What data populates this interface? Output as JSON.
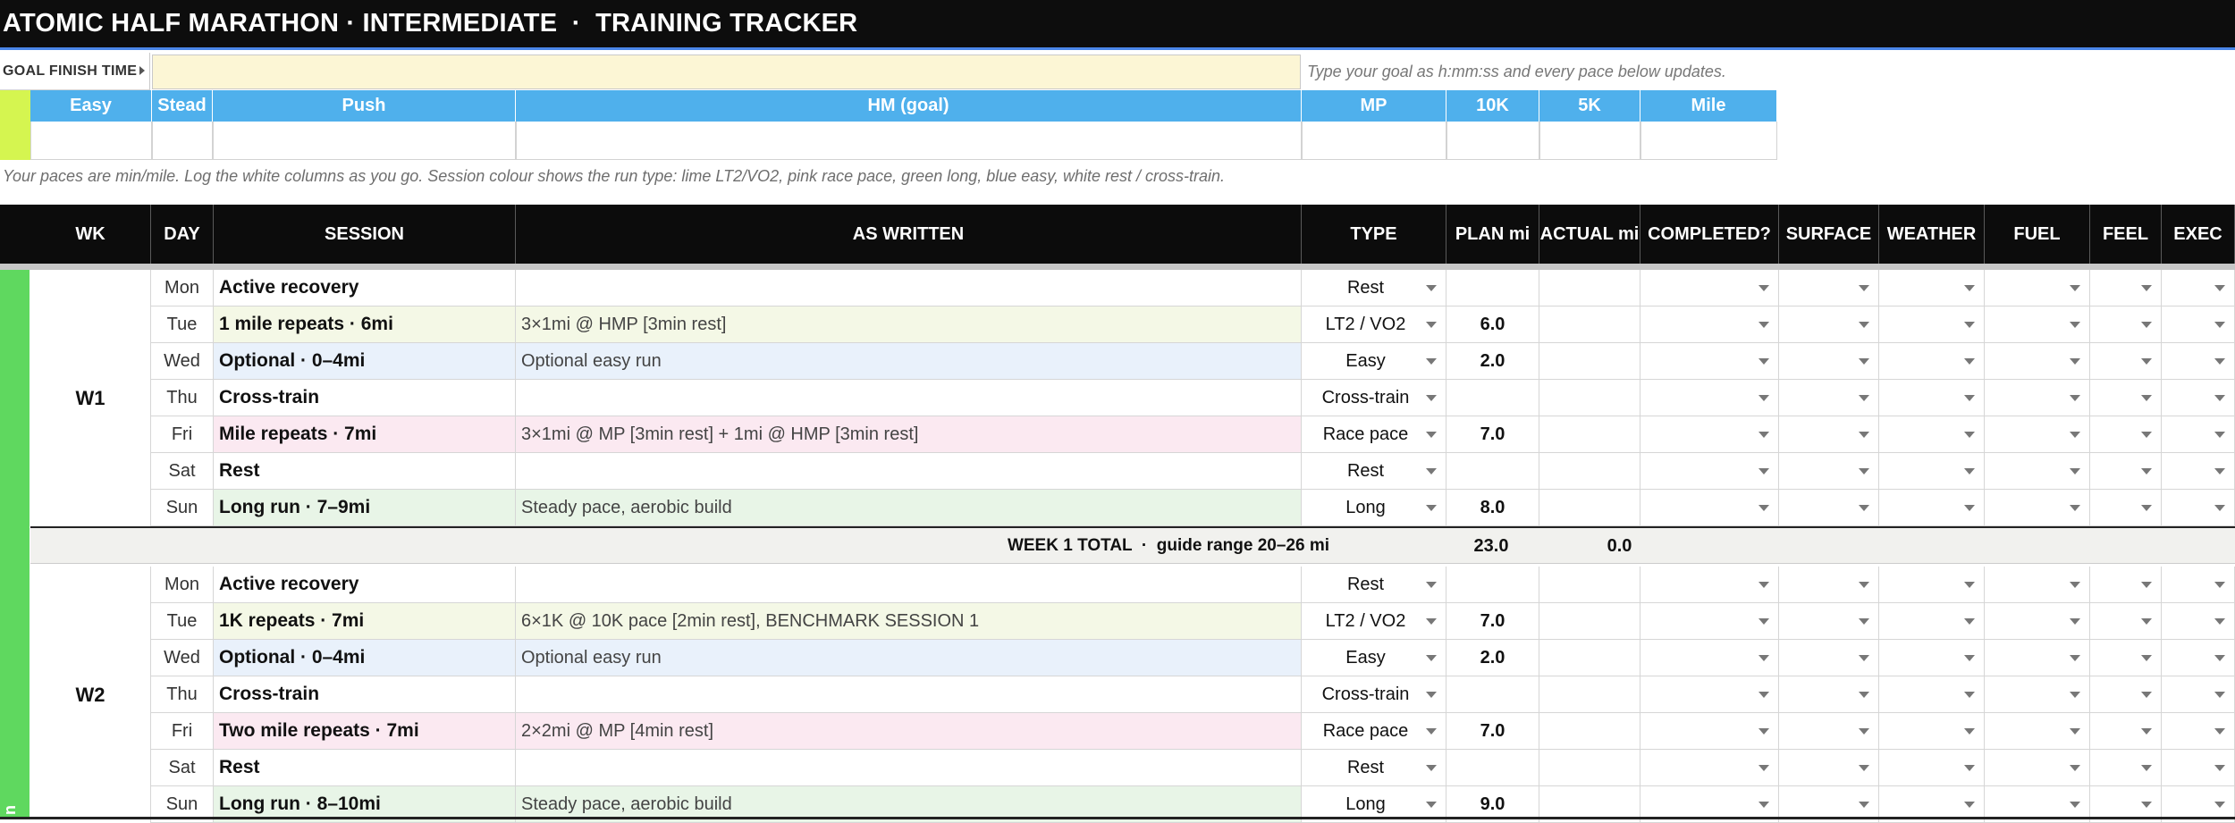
{
  "title": "ATOMIC HALF MARATHON · INTERMEDIATE  ·  TRAINING TRACKER",
  "goal": {
    "label": "GOAL FINISH TIME",
    "value": "",
    "hint": "Type your goal as h:mm:ss and every pace below updates."
  },
  "paces": {
    "headers": [
      "Easy",
      "Stead",
      "Push",
      "HM (goal)",
      "MP",
      "10K",
      "5K",
      "Mile"
    ],
    "values": [
      "",
      "",
      "",
      "",
      "",
      "",
      "",
      ""
    ]
  },
  "pace_note": "Your paces are min/mile. Log the white columns as you go. Session colour shows the run type: lime LT2/VO2, pink race pace, green long, blue easy, white rest / cross-train.",
  "columns": [
    "WK",
    "DAY",
    "SESSION",
    "AS WRITTEN",
    "TYPE",
    "PLAN mi",
    "ACTUAL mi",
    "COMPLETED?",
    "SURFACE",
    "WEATHER",
    "FUEL",
    "FEEL",
    "EXEC"
  ],
  "side_label": "n",
  "colors": {
    "lime": "#f4f8e6",
    "pink": "#fbe9f1",
    "green": "#e8f5e7",
    "blue": "#e9f1fb",
    "white": "#ffffff",
    "header_blue": "#4fb0ec",
    "week_strip": "#5fd85f"
  },
  "weeks": [
    {
      "label": "W1",
      "days": [
        {
          "day": "Mon",
          "session": "Active recovery",
          "written": "",
          "type": "Rest",
          "plan": "",
          "color": "white"
        },
        {
          "day": "Tue",
          "session": "1 mile repeats · 6mi",
          "written": "3×1mi @ HMP [3min rest]",
          "type": "LT2 / VO2",
          "plan": "6.0",
          "color": "lime"
        },
        {
          "day": "Wed",
          "session": "Optional · 0–4mi",
          "written": "Optional easy run",
          "type": "Easy",
          "plan": "2.0",
          "color": "blue"
        },
        {
          "day": "Thu",
          "session": "Cross-train",
          "written": "",
          "type": "Cross-train",
          "plan": "",
          "color": "white"
        },
        {
          "day": "Fri",
          "session": "Mile repeats · 7mi",
          "written": "3×1mi @ MP [3min rest] + 1mi @ HMP [3min rest]",
          "type": "Race pace",
          "plan": "7.0",
          "color": "pink"
        },
        {
          "day": "Sat",
          "session": "Rest",
          "written": "",
          "type": "Rest",
          "plan": "",
          "color": "white"
        },
        {
          "day": "Sun",
          "session": "Long run · 7–9mi",
          "written": "Steady pace, aerobic build",
          "type": "Long",
          "plan": "8.0",
          "color": "green"
        }
      ],
      "total_label": "WEEK 1 TOTAL  ·  guide range 20–26 mi",
      "total_plan": "23.0",
      "total_actual": "0.0"
    },
    {
      "label": "W2",
      "days": [
        {
          "day": "Mon",
          "session": "Active recovery",
          "written": "",
          "type": "Rest",
          "plan": "",
          "color": "white"
        },
        {
          "day": "Tue",
          "session": "1K repeats · 7mi",
          "written": "6×1K @ 10K pace [2min rest], BENCHMARK SESSION 1",
          "type": "LT2 / VO2",
          "plan": "7.0",
          "color": "lime"
        },
        {
          "day": "Wed",
          "session": "Optional · 0–4mi",
          "written": "Optional easy run",
          "type": "Easy",
          "plan": "2.0",
          "color": "blue"
        },
        {
          "day": "Thu",
          "session": "Cross-train",
          "written": "",
          "type": "Cross-train",
          "plan": "",
          "color": "white"
        },
        {
          "day": "Fri",
          "session": "Two mile repeats · 7mi",
          "written": "2×2mi @ MP [4min rest]",
          "type": "Race pace",
          "plan": "7.0",
          "color": "pink"
        },
        {
          "day": "Sat",
          "session": "Rest",
          "written": "",
          "type": "Rest",
          "plan": "",
          "color": "white"
        },
        {
          "day": "Sun",
          "session": "Long run · 8–10mi",
          "written": "Steady pace, aerobic build",
          "type": "Long",
          "plan": "9.0",
          "color": "green"
        }
      ]
    }
  ]
}
